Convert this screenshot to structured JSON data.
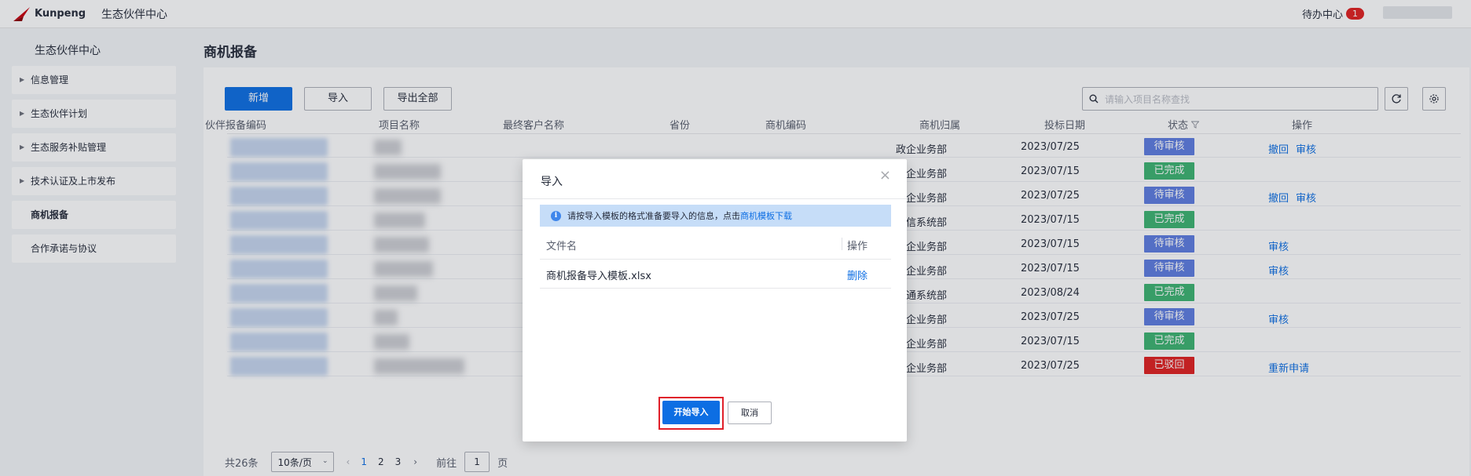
{
  "header": {
    "logo_text": "Kunpeng",
    "app_title": "生态伙伴中心",
    "todo_label": "待办中心",
    "todo_count": "1"
  },
  "sidebar": {
    "title": "生态伙伴中心",
    "items": [
      {
        "label": "信息管理"
      },
      {
        "label": "生态伙伴计划"
      },
      {
        "label": "生态服务补贴管理"
      },
      {
        "label": "技术认证及上市发布"
      },
      {
        "label": "商机报备"
      },
      {
        "label": "合作承诺与协议"
      }
    ]
  },
  "main": {
    "page_title": "商机报备",
    "toolbar": {
      "new_label": "新增",
      "import_label": "导入",
      "export_label": "导出全部",
      "search_placeholder": "请输入项目名称查找"
    },
    "columns": [
      "伙伴报备编码",
      "项目名称",
      "最终客户名称",
      "省份",
      "商机编码",
      "商机归属",
      "投标日期",
      "状态",
      "操作"
    ],
    "rows": [
      {
        "dept": "政企业务部",
        "date": "2023/07/25",
        "status": "待审核",
        "status_type": "pending",
        "ops": [
          "撤回",
          "审核"
        ]
      },
      {
        "dept": "政企业务部",
        "date": "2023/07/15",
        "status": "已完成",
        "status_type": "done",
        "ops": []
      },
      {
        "dept": "政企业务部",
        "date": "2023/07/25",
        "status": "待审核",
        "status_type": "pending",
        "ops": [
          "撤回",
          "审核"
        ]
      },
      {
        "dept": "电信系统部",
        "date": "2023/07/15",
        "status": "已完成",
        "status_type": "done",
        "ops": []
      },
      {
        "dept": "政企业务部",
        "date": "2023/07/15",
        "status": "待审核",
        "status_type": "pending",
        "ops": [
          "审核"
        ]
      },
      {
        "dept": "政企业务部",
        "date": "2023/07/15",
        "status": "待审核",
        "status_type": "pending",
        "ops": [
          "审核"
        ]
      },
      {
        "dept": "联通系统部",
        "date": "2023/08/24",
        "status": "已完成",
        "status_type": "done",
        "ops": []
      },
      {
        "dept": "政企业务部",
        "date": "2023/07/25",
        "status": "待审核",
        "status_type": "pending",
        "ops": [
          "审核"
        ]
      },
      {
        "dept": "政企业务部",
        "date": "2023/07/15",
        "status": "已完成",
        "status_type": "done",
        "ops": []
      },
      {
        "dept": "政企业务部",
        "date": "2023/07/25",
        "status": "已驳回",
        "status_type": "reject",
        "ops": [
          "重新申请"
        ]
      }
    ],
    "pagination": {
      "total": "共26条",
      "page_size": "10条/页",
      "pages": [
        "1",
        "2",
        "3"
      ],
      "current": "1",
      "goto_label": "前往",
      "goto_value": "1",
      "page_unit": "页"
    }
  },
  "dialog": {
    "title": "导入",
    "info_text": "请按导入模板的格式准备要导入的信息，点击",
    "info_link": "商机模板下载",
    "col_filename": "文件名",
    "col_action": "操作",
    "file_name": "商机报备导入模板.xlsx",
    "delete_label": "删除",
    "start_label": "开始导入",
    "cancel_label": "取消"
  },
  "colors": {
    "primary": "#0d6ee3",
    "pending": "#5e7ce0",
    "done": "#3cb371",
    "reject": "#e02020"
  }
}
